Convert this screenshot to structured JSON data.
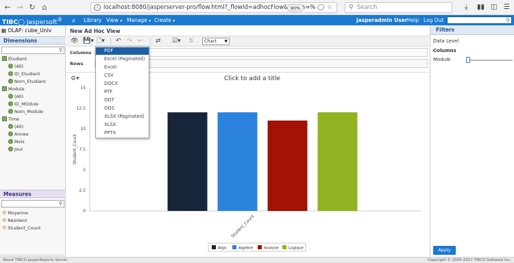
{
  "browser": {
    "url": "localhost:8080/jasperserver-pro/flow.html?_flowId=adhocFlow&realm=%",
    "zoom": "90%",
    "search_placeholder": "Search"
  },
  "app": {
    "brand_prefix": "TIBC",
    "brand_suffix": "Jaspersoft",
    "nav": [
      "Library",
      "View",
      "Manage",
      "Create"
    ],
    "user": "jasperadmin User",
    "help": "Help",
    "logout": "Log Out"
  },
  "left": {
    "cube_title": "OLAP: cube_Univ",
    "dimensions_title": "Dimensions",
    "tree": [
      {
        "label": "Etudiant",
        "kind": "dim"
      },
      {
        "label": "(All)",
        "kind": "level"
      },
      {
        "label": "ID_Etudiant",
        "kind": "level"
      },
      {
        "label": "Nom_Etudiant",
        "kind": "level"
      },
      {
        "label": "Module",
        "kind": "dim"
      },
      {
        "label": "(All)",
        "kind": "level"
      },
      {
        "label": "ID_MOdule",
        "kind": "level"
      },
      {
        "label": "Nom_Module",
        "kind": "level"
      },
      {
        "label": "Time",
        "kind": "dim"
      },
      {
        "label": "(All)",
        "kind": "level"
      },
      {
        "label": "Annee",
        "kind": "level"
      },
      {
        "label": "Mois",
        "kind": "level"
      },
      {
        "label": "Jour",
        "kind": "level"
      }
    ],
    "measures_title": "Measures",
    "measures": [
      "Moyenne",
      "Résident",
      "Student_Count"
    ]
  },
  "center": {
    "view_title": "New Ad Hoc View",
    "chart_type": "Chart",
    "columns_label": "Columns",
    "rows_label": "Rows",
    "chart_title_placeholder": "Click to add a title"
  },
  "export_menu": [
    "PDF",
    "Excel (Paginated)",
    "Excel",
    "CSV",
    "DOCX",
    "RTF",
    "ODT",
    "ODS",
    "XLSX (Paginated)",
    "XLSX",
    "PPTX"
  ],
  "export_selected": 0,
  "right": {
    "filters_title": "Filters",
    "data_level": "Data Level",
    "columns": "Columns",
    "module": "Module",
    "apply": "Apply"
  },
  "status": {
    "left": "About TIBCO JasperReports Server",
    "right": "Copyright © 2005-2017 TIBCO Software Inc."
  },
  "colors": {
    "header_blue": "#1a79d0",
    "menu_selected": "#1d5fa3"
  },
  "chart_data": {
    "type": "bar",
    "categories": [
      "Student_Count"
    ],
    "series": [
      {
        "name": "Algo",
        "values": [
          12
        ],
        "color": "#16253a"
      },
      {
        "name": "Algebre",
        "values": [
          12
        ],
        "color": "#2c83dd"
      },
      {
        "name": "Analyse",
        "values": [
          11
        ],
        "color": "#a31205"
      },
      {
        "name": "Logique",
        "values": [
          12
        ],
        "color": "#92b321"
      }
    ],
    "ylabel": "Student_Count",
    "xlabel": "",
    "ylim": [
      0,
      15
    ],
    "yticks": [
      0,
      2.5,
      5,
      7.5,
      10,
      12.5,
      15
    ],
    "legend_position": "bottom",
    "grid": false
  }
}
